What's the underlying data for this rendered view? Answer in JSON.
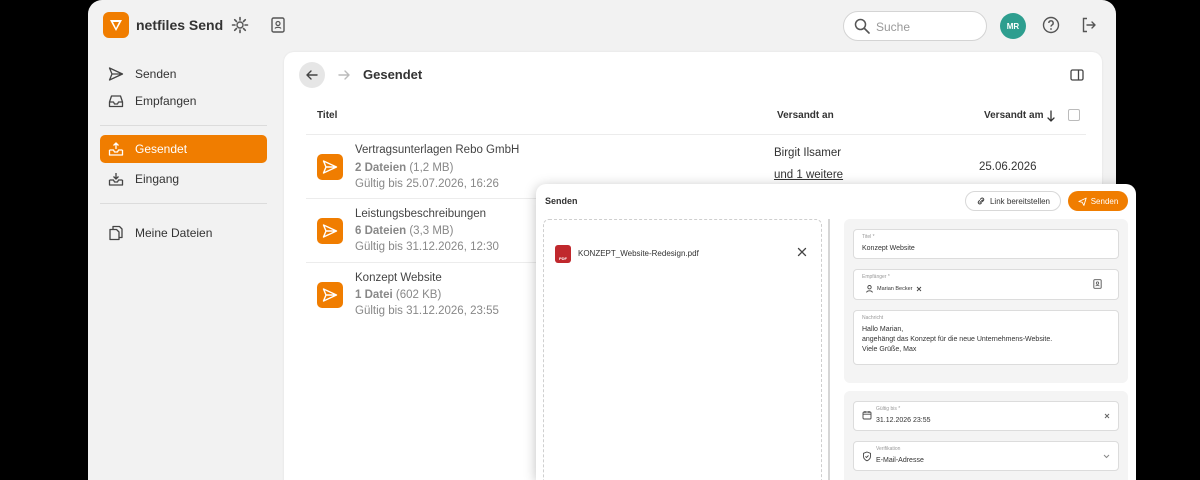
{
  "app": {
    "brand": "netfiles Send"
  },
  "topbar": {
    "search_placeholder": "Suche",
    "avatar_initials": "MR"
  },
  "sidebar": {
    "items": [
      {
        "label": "Senden",
        "icon": "send-icon"
      },
      {
        "label": "Empfangen",
        "icon": "inbox-icon"
      },
      {
        "label": "Gesendet",
        "icon": "outbox-icon",
        "active": true
      },
      {
        "label": "Eingang",
        "icon": "download-tray-icon"
      },
      {
        "label": "Meine Dateien",
        "icon": "files-icon"
      }
    ]
  },
  "main": {
    "title": "Gesendet",
    "columns": {
      "title": "Titel",
      "sent_to": "Versandt an",
      "sent_on": "Versandt am"
    },
    "rows": [
      {
        "title": "Vertragsunterlagen Rebo GmbH",
        "files": "2 Dateien",
        "size": "(1,2 MB)",
        "valid": "Gültig bis 25.07.2026, 16:26",
        "recipient": "Birgit Ilsamer",
        "more": "und 1 weitere",
        "date": "25.06.2026"
      },
      {
        "title": "Leistungsbeschreibungen",
        "files": "6 Dateien",
        "size": "(3,3 MB)",
        "valid": "Gültig bis 31.12.2026, 12:30"
      },
      {
        "title": "Konzept Website",
        "files": "1 Datei",
        "size": "(602 KB)",
        "valid": "Gültig bis 31.12.2026, 23:55"
      }
    ]
  },
  "modal": {
    "title": "Senden",
    "link_button": "Link bereitstellen",
    "send_button": "Senden",
    "file_name": "KONZEPT_Website-Redesign.pdf",
    "file_badge": "PDF",
    "fields": {
      "title_label": "Titel *",
      "title_value": "Konzept Website",
      "recipients_label": "Empfänger *",
      "recipient_chip": "Marian Becker",
      "message_label": "Nachricht",
      "message_lines": [
        "Hallo Marian,",
        "angehängt das Konzept für die neue Unternehmens-Website.",
        "Viele Grüße, Max"
      ],
      "valid_label": "Gültig bis *",
      "valid_value": "31.12.2026 23:55",
      "verification_label": "Verifikation",
      "verification_value": "E-Mail-Adresse"
    }
  },
  "colors": {
    "accent": "#f07d00",
    "avatar": "#2e9e8f",
    "pdf": "#c0282d"
  }
}
